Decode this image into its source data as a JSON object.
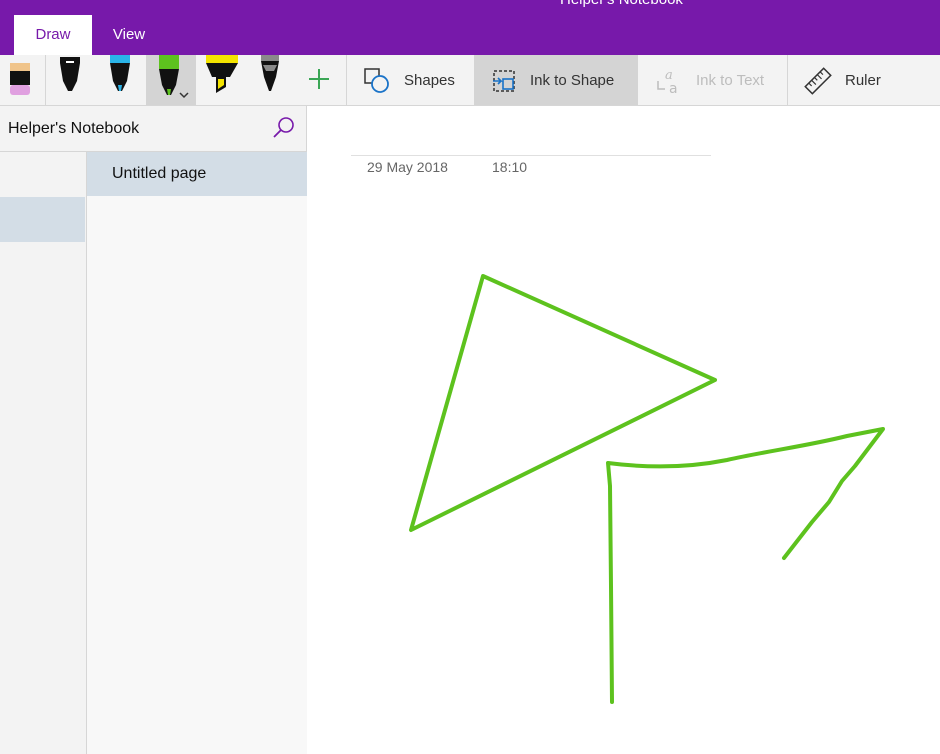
{
  "app": {
    "title": "Helper's Notebook"
  },
  "tabs": [
    {
      "label": "Draw",
      "active": true
    },
    {
      "label": "View",
      "active": false
    }
  ],
  "ribbon": {
    "pens": [
      {
        "name": "eraser-icon",
        "color": "#e0a0e0"
      },
      {
        "name": "pen-black-icon",
        "color": "#111111"
      },
      {
        "name": "pen-blue-icon",
        "color": "#2ab4e8"
      },
      {
        "name": "pen-green-icon",
        "color": "#5dc21e",
        "selected": true
      },
      {
        "name": "highlighter-yellow-icon",
        "color": "#f4e400"
      },
      {
        "name": "pencil-gray-icon",
        "color": "#8a8a8a"
      }
    ],
    "shapes_label": "Shapes",
    "ink_to_shape_label": "Ink to Shape",
    "ink_to_text_label": "Ink to Text",
    "ruler_label": "Ruler"
  },
  "navigation": {
    "notebook_name": "Helper's Notebook",
    "pages": [
      {
        "label": "Untitled page",
        "selected": true
      }
    ]
  },
  "page": {
    "date": "29 May 2018",
    "time": "18:10",
    "ink_color": "#5dc21e"
  },
  "colors": {
    "accent": "#7719aa",
    "ribbon_bg": "#f3f3f3",
    "selected_bg": "#d3dde6"
  }
}
